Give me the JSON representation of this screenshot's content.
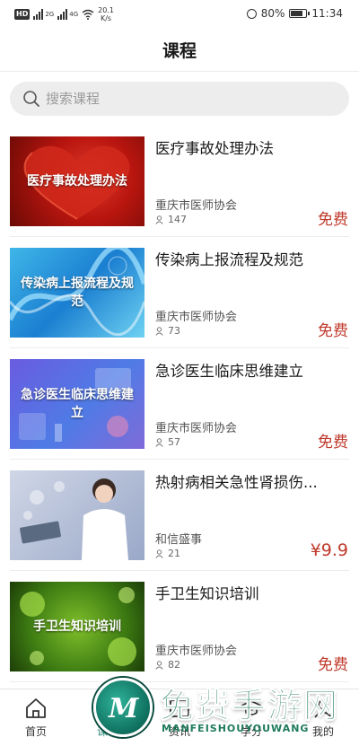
{
  "status_bar": {
    "hd_badge": "HD",
    "sim1_label": "2G",
    "sim2_label": "4G",
    "net_speed_value": "20.1",
    "net_speed_unit": "K/s",
    "battery_percent": "80%",
    "time": "11:34"
  },
  "header": {
    "title": "课程"
  },
  "search": {
    "placeholder": "搜索课程"
  },
  "courses": [
    {
      "thumb_text": "医疗事故处理办法",
      "title": "医疗事故处理办法",
      "org": "重庆市医师协会",
      "count": "147",
      "price": "免费"
    },
    {
      "thumb_text": "传染病上报流程及规范",
      "title": "传染病上报流程及规范",
      "org": "重庆市医师协会",
      "count": "73",
      "price": "免费"
    },
    {
      "thumb_text": "急诊医生临床思维建立",
      "title": "急诊医生临床思维建立",
      "org": "重庆市医师协会",
      "count": "57",
      "price": "免费"
    },
    {
      "thumb_text": "",
      "title": "热射病相关急性肾损伤...",
      "org": "和信盛事",
      "count": "21",
      "price": "¥9.9"
    },
    {
      "thumb_text": "手卫生知识培训",
      "title": "手卫生知识培训",
      "org": "重庆市医师协会",
      "count": "82",
      "price": "免费"
    }
  ],
  "tabs": [
    {
      "label": "首页",
      "icon": "home-icon"
    },
    {
      "label": "课程",
      "icon": "course-icon"
    },
    {
      "label": "资讯",
      "icon": "news-icon"
    },
    {
      "label": "学分",
      "icon": "credit-icon"
    },
    {
      "label": "我的",
      "icon": "profile-icon"
    }
  ],
  "watermark": {
    "logo_letter": "M",
    "text": "免费手游网",
    "subtext": "MANFEISHOUYOUWANG"
  },
  "colors": {
    "price": "#c0392b",
    "active_tab": "#2a8a7a",
    "search_bg": "#ededed"
  }
}
